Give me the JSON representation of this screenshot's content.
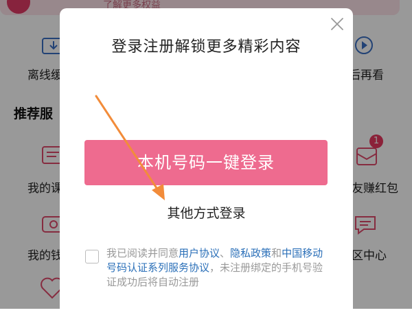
{
  "background": {
    "banner_text": "了解更多权益",
    "top_row": [
      {
        "label": "离线缓",
        "icon": "download-icon"
      },
      {
        "label": "后再看",
        "icon": "play-later-icon"
      }
    ],
    "section_title": "推荐服",
    "grid": [
      {
        "label": "我的课",
        "icon": "course-icon"
      },
      {
        "label": "友赚红包",
        "icon": "red-packet-icon"
      },
      {
        "label": "我的钱",
        "icon": "wallet-icon"
      },
      {
        "label": "区中心",
        "icon": "chat-icon"
      },
      {
        "label": "",
        "icon": "heart-icon"
      }
    ],
    "badge": "1"
  },
  "modal": {
    "title": "登录注册解锁更多精彩内容",
    "login_button": "本机号码一键登录",
    "other_login": "其他方式登录",
    "agreement": {
      "prefix": "我已阅读并同意",
      "link1": "用户协议",
      "sep1": "、",
      "link2": "隐私政策",
      "and": "和",
      "link3": "中国移动号码认证系列服务协议",
      "suffix": "，未注册绑定的手机号验证成功后将自动注册"
    }
  },
  "colors": {
    "accent": "#ee6b8f",
    "link": "#2a6fb8",
    "arrow": "#f28c3a",
    "badge": "#e8385f"
  }
}
